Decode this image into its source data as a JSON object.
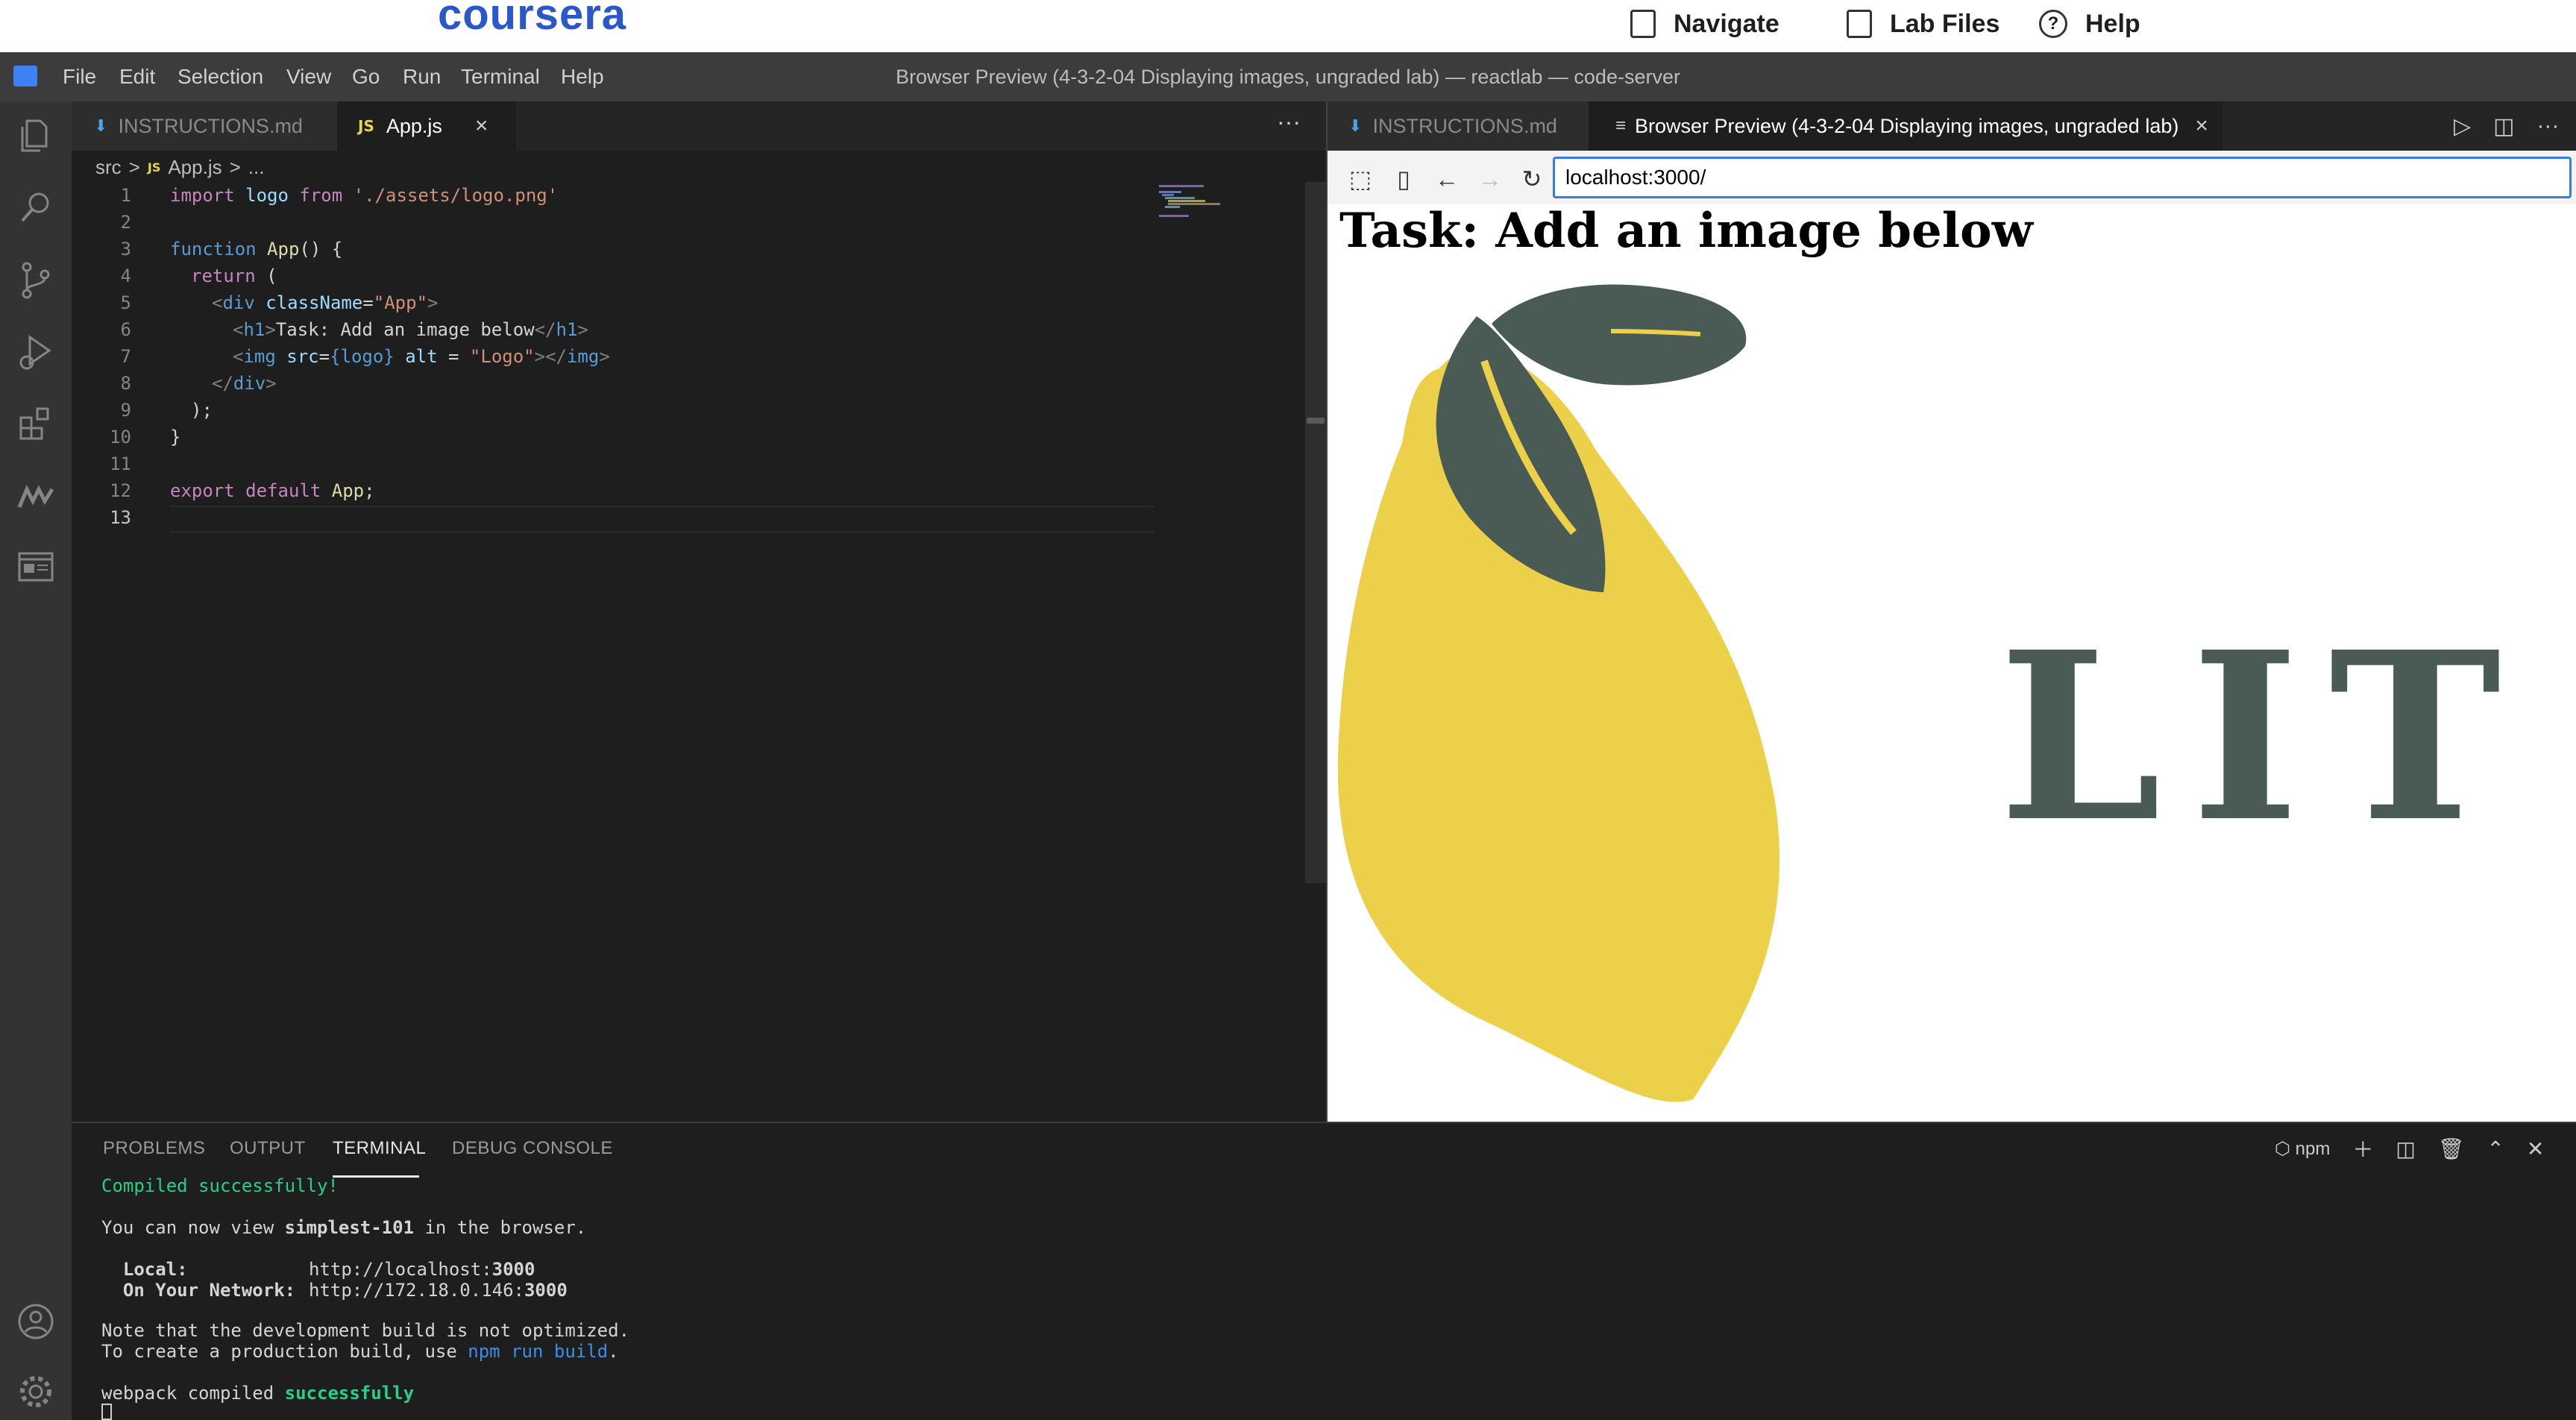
{
  "coursera": {
    "logo": "coursera",
    "nav": [
      {
        "label": "Navigate",
        "icon": "navigate-icon"
      },
      {
        "label": "Lab Files",
        "icon": "lab-files-icon"
      },
      {
        "label": "Help",
        "icon": "help-icon"
      }
    ]
  },
  "menubar": {
    "items": [
      "File",
      "Edit",
      "Selection",
      "View",
      "Go",
      "Run",
      "Terminal",
      "Help"
    ],
    "window_title": "Browser Preview (4-3-2-04 Displaying images, ungraded lab) — reactlab — code-server"
  },
  "activity_bar": [
    "explorer-icon",
    "search-icon",
    "source-control-icon",
    "run-debug-icon",
    "extensions-icon",
    "remote-icon",
    "browser-preview-icon",
    "account-icon",
    "manage-gear-icon"
  ],
  "editor_left": {
    "tabs": [
      {
        "label": "INSTRUCTIONS.md",
        "active": false
      },
      {
        "label": "App.js",
        "active": true
      }
    ],
    "tab_close": "×",
    "more": "···",
    "breadcrumb": {
      "folder": "src",
      "file": "App.js",
      "rest": "...",
      "sep": ">"
    },
    "line_numbers": [
      "1",
      "2",
      "3",
      "4",
      "5",
      "6",
      "7",
      "8",
      "9",
      "10",
      "11",
      "12",
      "13"
    ],
    "code": {
      "l1": {
        "kw": "import",
        "id": " logo ",
        "from": "from",
        "str": " './assets/logo.png'"
      },
      "l3": {
        "kw": "function",
        "fn": " App",
        "rest": "() {"
      },
      "l4": {
        "kw": "return",
        "rest": " ("
      },
      "l5": {
        "open": "<",
        "tag": "div",
        "attr": " className",
        "eq": "=",
        "str": "\"App\"",
        "close": ">"
      },
      "l6": {
        "open": "<",
        "tag": "h1",
        "close": ">",
        "text": "Task: Add an image below",
        "end_open": "</",
        "end_close": ">"
      },
      "l7": {
        "open": "<",
        "tag": "img",
        "attr1": " src",
        "eq": "=",
        "expr": "{logo}",
        "attr2": " alt",
        "eq2": " = ",
        "str": "\"Logo\"",
        "close": "></",
        "tag2": "img",
        "end": ">"
      },
      "l8": {
        "open": "</",
        "tag": "div",
        "close": ">"
      },
      "l9": {
        "text": ");"
      },
      "l10": {
        "text": "}"
      },
      "l12": {
        "kw": "export",
        "kw2": " default",
        "id": " App",
        "semi": ";"
      }
    }
  },
  "editor_right": {
    "tabs": [
      {
        "label": "INSTRUCTIONS.md",
        "active": false
      },
      {
        "label": "Browser Preview (4-3-2-04 Displaying images, ungraded lab)",
        "active": true
      }
    ],
    "tab_close": "×",
    "url": "localhost:3000/",
    "page": {
      "heading": "Task: Add an image below",
      "image_alt": "Logo",
      "image_text": "LIT"
    }
  },
  "panel": {
    "tabs": [
      "PROBLEMS",
      "OUTPUT",
      "TERMINAL",
      "DEBUG CONSOLE"
    ],
    "active_tab": "TERMINAL",
    "terminal_selector": "npm",
    "terminal": {
      "compiled": "Compiled successfully!",
      "view_pre": "You can now view ",
      "app_name": "simplest-101",
      "view_post": " in the browser.",
      "local_label": "  Local:",
      "local_url_pre": "http://localhost:",
      "local_port": "3000",
      "network_label": "  On Your Network:",
      "network_url_pre": "http://172.18.0.146:",
      "network_port": "3000",
      "note1": "Note that the development build is not optimized.",
      "note2_pre": "To create a production build, use ",
      "note2_cmd": "npm run build",
      "note2_post": ".",
      "webpack_pre": "webpack compiled ",
      "webpack_status": "successfully"
    }
  },
  "colors": {
    "coursera_blue": "#2a58c8",
    "lemon": "#ecd04a",
    "leaf": "#4a5a55",
    "terminal_green": "#23d18b",
    "url_focus": "#3a7be0"
  }
}
